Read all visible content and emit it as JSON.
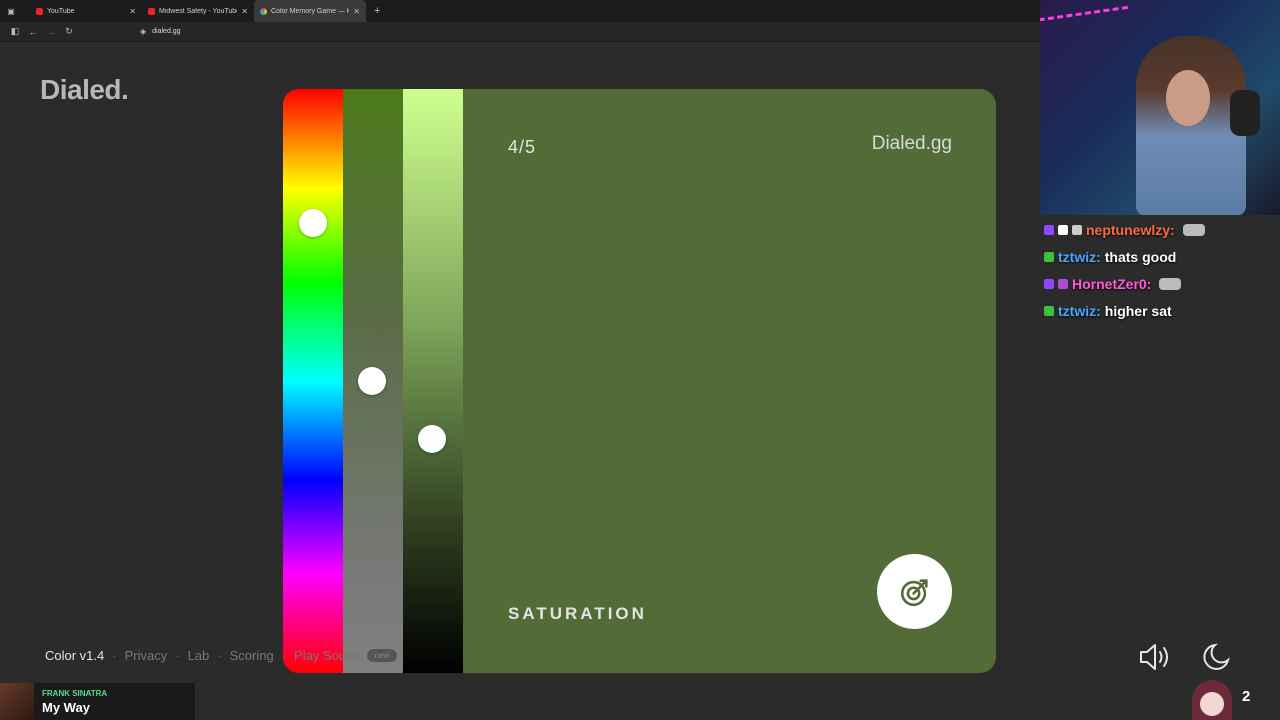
{
  "browser": {
    "tabs": [
      {
        "title": "YouTube",
        "active": false
      },
      {
        "title": "Midwest Safety - YouTube",
        "active": false
      },
      {
        "title": "Color Memory Game — Ho",
        "active": true
      }
    ],
    "url": "dialed.gg"
  },
  "page": {
    "logo": "Dialed.",
    "round": "4/5",
    "brand": "Dialed.gg",
    "mode_label": "SATURATION",
    "current_color": "#536b37",
    "sliders": {
      "hue_level": 0.23,
      "saturation_level": 0.5,
      "brightness_level": 0.6
    },
    "footer": {
      "version": "Color v1.4",
      "links": [
        "Privacy",
        "Lab",
        "Scoring",
        "Play Sound"
      ],
      "badge": "new"
    },
    "controls": {
      "sound_icon": "speaker-icon",
      "theme_icon": "moon-icon",
      "submit_icon": "target-arrow-icon"
    }
  },
  "stream": {
    "chat": [
      {
        "user": "neptunewlzy:",
        "user_color": "#ff6a3d",
        "message": "",
        "badges": [
          "#9146ff",
          "#ffffff"
        ]
      },
      {
        "user": "tztwiz:",
        "user_color": "#4aa8ff",
        "message": "thats good",
        "badges": [
          "#3cc13c"
        ]
      },
      {
        "user": "HornetZer0:",
        "user_color": "#ff5ad9",
        "message": "",
        "badges": [
          "#9146ff",
          "#b04ad0"
        ]
      },
      {
        "user": "tztwiz:",
        "user_color": "#4aa8ff",
        "message": "higher sat",
        "badges": [
          "#3cc13c"
        ]
      }
    ],
    "now_playing": {
      "artist": "FRANK SINATRA",
      "song": "My Way"
    },
    "viewer_count": "2"
  }
}
